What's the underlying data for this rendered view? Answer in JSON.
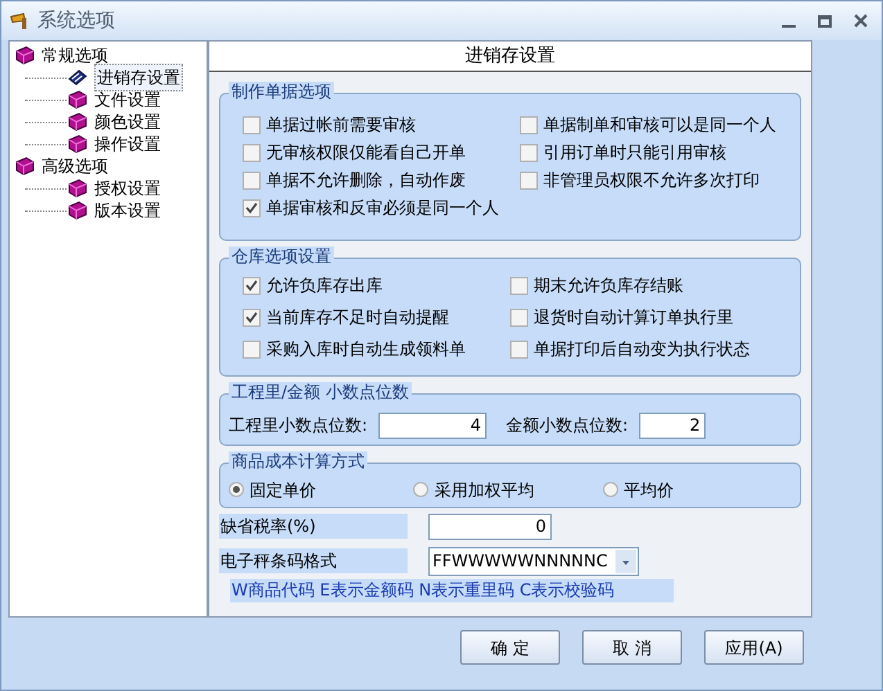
{
  "window": {
    "title": "系统选项"
  },
  "tree": [
    {
      "label": "常规选项",
      "selected": false,
      "children": [
        {
          "label": "进销存设置",
          "selected": true
        },
        {
          "label": "文件设置",
          "selected": false
        },
        {
          "label": "颜色设置",
          "selected": false
        },
        {
          "label": "操作设置",
          "selected": false
        }
      ]
    },
    {
      "label": "高级选项",
      "selected": false,
      "children": [
        {
          "label": "授权设置",
          "selected": false
        },
        {
          "label": "版本设置",
          "selected": false
        }
      ]
    }
  ],
  "panel_title": "进销存设置",
  "document_options": {
    "title": "制作单据选项",
    "options": [
      {
        "label": "单据过帐前需要审核",
        "checked": false
      },
      {
        "label": "单据制单和审核可以是同一个人",
        "checked": false
      },
      {
        "label": "无审核权限仅能看自己开单",
        "checked": false
      },
      {
        "label": "引用订单时只能引用审核",
        "checked": false
      },
      {
        "label": "单据不允许删除，自动作废",
        "checked": false
      },
      {
        "label": "非管理员权限不允许多次打印",
        "checked": false
      },
      {
        "label": "单据审核和反审必须是同一个人",
        "checked": true
      }
    ]
  },
  "warehouse_options": {
    "title": "仓库选项设置",
    "options": [
      {
        "label": "允许负库存出库",
        "checked": true
      },
      {
        "label": "期末允许负库存结账",
        "checked": false
      },
      {
        "label": "当前库存不足时自动提醒",
        "checked": true
      },
      {
        "label": "退货时自动计算订单执行里",
        "checked": false
      },
      {
        "label": "采购入库时自动生成领料单",
        "checked": false
      },
      {
        "label": "单据打印后自动变为执行状态",
        "checked": false
      }
    ]
  },
  "decimals": {
    "title": "工程里/金额 小数点位数",
    "fields": [
      {
        "label": "工程里小数点位数:",
        "value": "4"
      },
      {
        "label": "金额小数点位数:",
        "value": "2"
      }
    ]
  },
  "cost_method": {
    "title": "商品成本计算方式",
    "options": [
      {
        "label": "固定单价",
        "selected": true
      },
      {
        "label": "采用加权平均",
        "selected": false
      },
      {
        "label": "平均价",
        "selected": false
      }
    ]
  },
  "tax_rate": {
    "label": "缺省税率(%)",
    "value": "0"
  },
  "barcode": {
    "label": "电子秤条码格式",
    "value": "FFWWWWWNNNNNC",
    "hint": "W商品代码 E表示金额码 N表示重里码 C表示校验码"
  },
  "buttons": [
    "确 定",
    "取 消",
    "应用(A)"
  ]
}
